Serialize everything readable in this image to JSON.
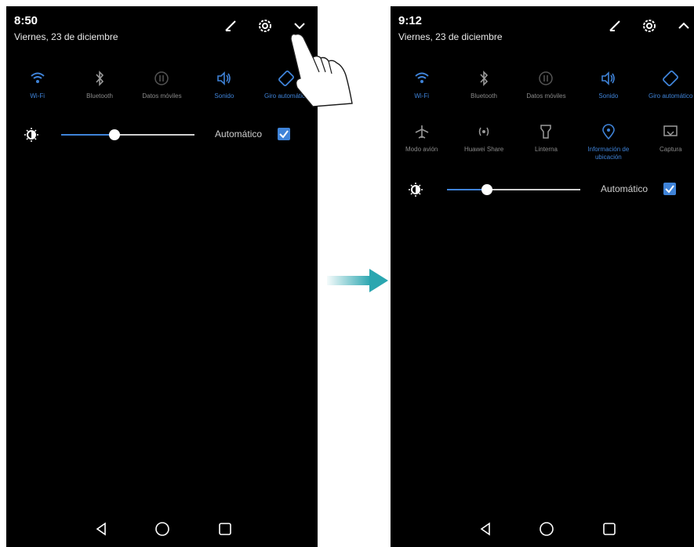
{
  "left": {
    "time": "8:50",
    "date": "Viernes, 23 de diciembre",
    "header_icons": [
      "edit-icon",
      "settings-icon",
      "chevron-down-icon"
    ],
    "toggles": [
      {
        "label": "Wi-Fi",
        "icon": "wifi-icon",
        "on": true
      },
      {
        "label": "Bluetooth",
        "icon": "bluetooth-icon",
        "on": false
      },
      {
        "label": "Datos móviles",
        "icon": "mobile-data-icon",
        "on": false
      },
      {
        "label": "Sonido",
        "icon": "sound-icon",
        "on": true
      },
      {
        "label": "Giro automático",
        "icon": "auto-rotate-icon",
        "on": true
      }
    ],
    "brightness": {
      "auto_label": "Automático",
      "level": 0.4,
      "auto_checked": true
    }
  },
  "right": {
    "time": "9:12",
    "date": "Viernes, 23 de diciembre",
    "header_icons": [
      "edit-icon",
      "settings-icon",
      "chevron-up-icon"
    ],
    "toggles_row1": [
      {
        "label": "Wi-Fi",
        "icon": "wifi-icon",
        "on": true
      },
      {
        "label": "Bluetooth",
        "icon": "bluetooth-icon",
        "on": false
      },
      {
        "label": "Datos móviles",
        "icon": "mobile-data-icon",
        "on": false
      },
      {
        "label": "Sonido",
        "icon": "sound-icon",
        "on": true
      },
      {
        "label": "Giro automático",
        "icon": "auto-rotate-icon",
        "on": true
      }
    ],
    "toggles_row2": [
      {
        "label": "Modo avión",
        "icon": "airplane-icon",
        "on": false
      },
      {
        "label": "Huawei Share",
        "icon": "share-icon",
        "on": false
      },
      {
        "label": "Linterna",
        "icon": "flashlight-icon",
        "on": false
      },
      {
        "label": "Información de ubicación",
        "icon": "location-icon",
        "on": true
      },
      {
        "label": "Captura",
        "icon": "screenshot-icon",
        "on": false
      }
    ],
    "brightness": {
      "auto_label": "Automático",
      "level": 0.3,
      "auto_checked": true
    }
  },
  "nav_icons": [
    "back-icon",
    "home-icon",
    "recents-icon"
  ],
  "colors": {
    "accent": "#3f83d8",
    "background": "#000000",
    "arrow": "#2aa6b0"
  }
}
